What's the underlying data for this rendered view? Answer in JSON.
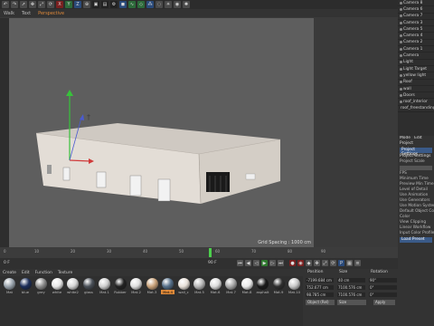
{
  "menubar": {
    "items": [
      "Walk",
      "Text",
      "Perspective"
    ],
    "active_index": 2
  },
  "viewport": {
    "grid_spacing": "Grid Spacing : 1000 cm"
  },
  "object_manager": {
    "items": [
      "Camera 8",
      "Camera 6",
      "Camera 7",
      "Camera 3",
      "Camera 5",
      "Camera 4",
      "Camera 2",
      "Camera 1",
      "Camera",
      "Light",
      "Light Target",
      "yellow light",
      "Roof",
      "wall",
      "Doors",
      "roof_interior",
      "roof_freestanding"
    ]
  },
  "attributes": {
    "tabs": [
      "Mode",
      "Edit"
    ],
    "title": "Project",
    "tab_active": "Project Settings",
    "section_header": "Project Settings",
    "rows": [
      "Project Scale",
      "FPS",
      "Minimum Time",
      "Preview Min Time",
      "Level of Detail",
      "Use Animation",
      "Use Generators",
      "Use Motion System",
      "Default Object Color",
      "Color",
      "View Clipping",
      "Linear Workflow",
      "Input Color Profile"
    ],
    "button": "Load Preset"
  },
  "timeline": {
    "ticks": [
      "0",
      "10",
      "20",
      "30",
      "40",
      "50",
      "60",
      "70",
      "80",
      "90"
    ],
    "current_frame": "0 F",
    "end_frame": "90 F"
  },
  "material_manager": {
    "menu": [
      "Create",
      "Edit",
      "Function",
      "Texture"
    ],
    "materials": [
      {
        "name": "Mat",
        "color": "#9aa4ad"
      },
      {
        "name": "blue",
        "color": "#1c2e5a"
      },
      {
        "name": "grey",
        "color": "#8c8c8c"
      },
      {
        "name": "white",
        "color": "#e8e8e8"
      },
      {
        "name": "white2",
        "color": "#d6d6d6"
      },
      {
        "name": "glass",
        "color": "#4a5058"
      },
      {
        "name": "Mat.1",
        "color": "#cfcfcf"
      },
      {
        "name": "Rubber",
        "color": "#222222"
      },
      {
        "name": "Mat.2",
        "color": "#e0e0e0"
      },
      {
        "name": "Mat.3",
        "color": "#c9a27a"
      },
      {
        "name": "Mat.4",
        "color": "#56708a"
      },
      {
        "name": "wall_c",
        "color": "#e8e0d8"
      },
      {
        "name": "Mat.5",
        "color": "#b7b7b7"
      },
      {
        "name": "Mat.6",
        "color": "#dcdcdc"
      },
      {
        "name": "Mat.7",
        "color": "#a8a8a8"
      },
      {
        "name": "Mat.8",
        "color": "#ececec"
      },
      {
        "name": "asphalt",
        "color": "#1a1a1a"
      },
      {
        "name": "Mat.9",
        "color": "#2f2f2f"
      },
      {
        "name": "Mat.10",
        "color": "#c8c8c8"
      }
    ],
    "selected_index": 10
  },
  "coordinates": {
    "headers": [
      "Position",
      "Size",
      "Rotation"
    ],
    "position": [
      "-7199.684 cm",
      "752.677 cm",
      "98.785 cm"
    ],
    "size": [
      "40 cm",
      "7100.576 cm",
      "7100.576 cm"
    ],
    "rotation": [
      "90°",
      "0°",
      "0°"
    ],
    "mode": "Object (Rel)",
    "size_mode": "Size",
    "apply": "Apply"
  }
}
